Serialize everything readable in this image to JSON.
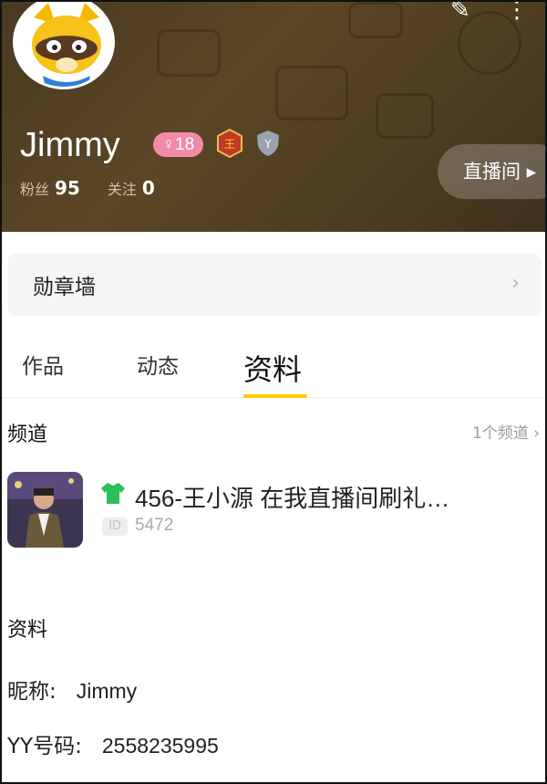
{
  "profile": {
    "username": "Jimmy",
    "level": "18",
    "fans_label": "粉丝",
    "fans_count": "95",
    "following_label": "关注",
    "following_count": "0",
    "live_button": "直播间 ▸"
  },
  "medal_wall": {
    "label": "勋章墙"
  },
  "tabs": [
    {
      "label": "作品"
    },
    {
      "label": "动态"
    },
    {
      "label": "资料",
      "active": true
    }
  ],
  "channel": {
    "section_title": "频道",
    "count_text": "1个频道 ›",
    "title": "456-王小源 在我直播间刷礼…",
    "id_badge": "ID",
    "id_value": "5472"
  },
  "info": {
    "section_title": "资料",
    "nickname_label": "昵称:",
    "nickname_value": "Jimmy",
    "yy_label": "YY号码:",
    "yy_value": "2558235995"
  },
  "colors": {
    "header_bg": "#4e3d22",
    "level_badge": "#f28aa8",
    "tab_underline": "#ffcc00"
  }
}
